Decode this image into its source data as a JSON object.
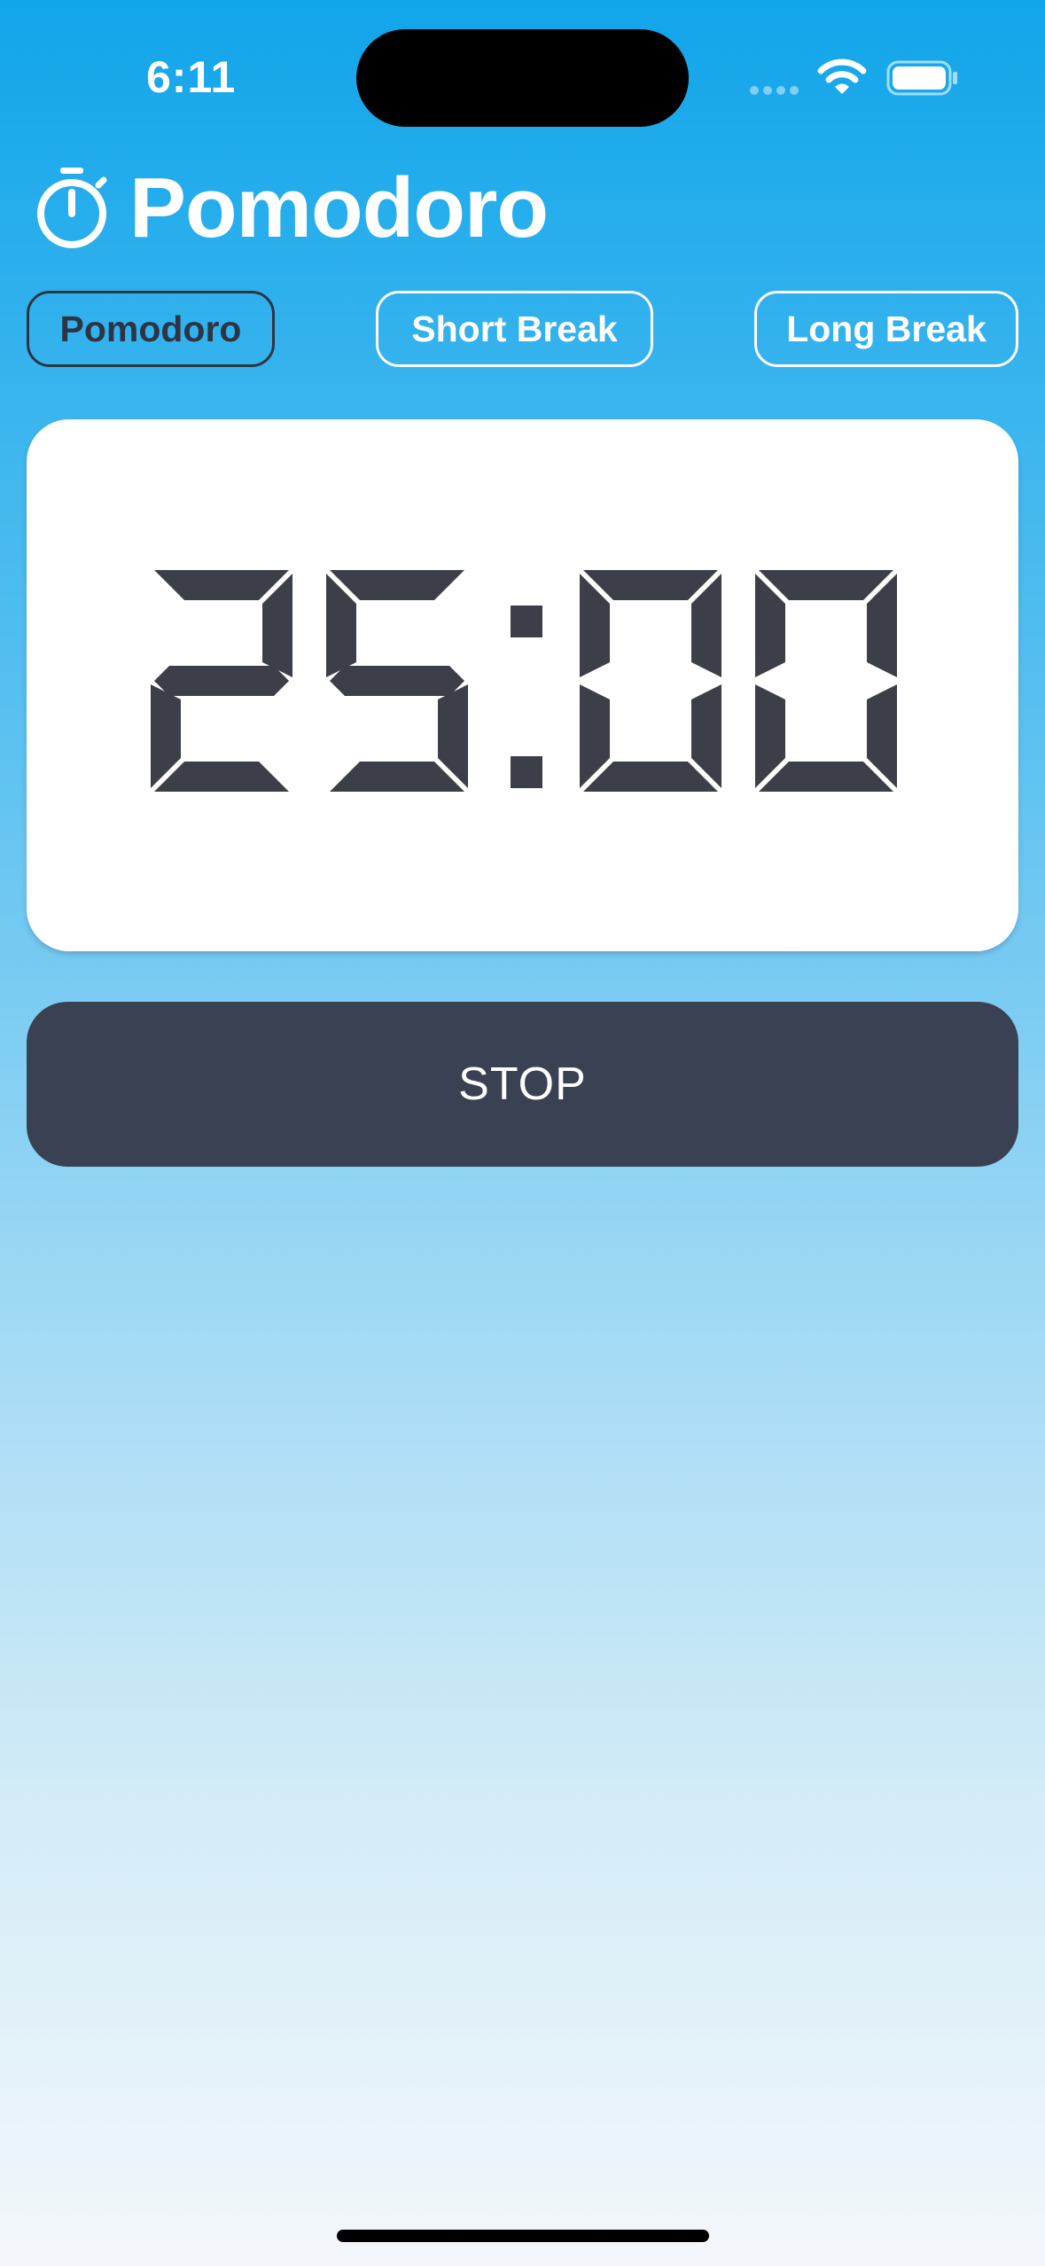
{
  "status_bar": {
    "time": "6:11"
  },
  "header": {
    "title": "Pomodoro",
    "icon": "stopwatch-icon"
  },
  "tabs": [
    {
      "label": "Pomodoro",
      "selected": true
    },
    {
      "label": "Short Break",
      "selected": false
    },
    {
      "label": "Long Break",
      "selected": false
    }
  ],
  "timer": {
    "display": "25:00"
  },
  "controls": {
    "stop_label": "STOP"
  },
  "colors": {
    "gradient_top": "#11a5ea",
    "gradient_bottom": "#f3f7fb",
    "digit_color": "#3d3f48",
    "button_bg": "#394152",
    "active_tab_border": "#2d3545"
  }
}
